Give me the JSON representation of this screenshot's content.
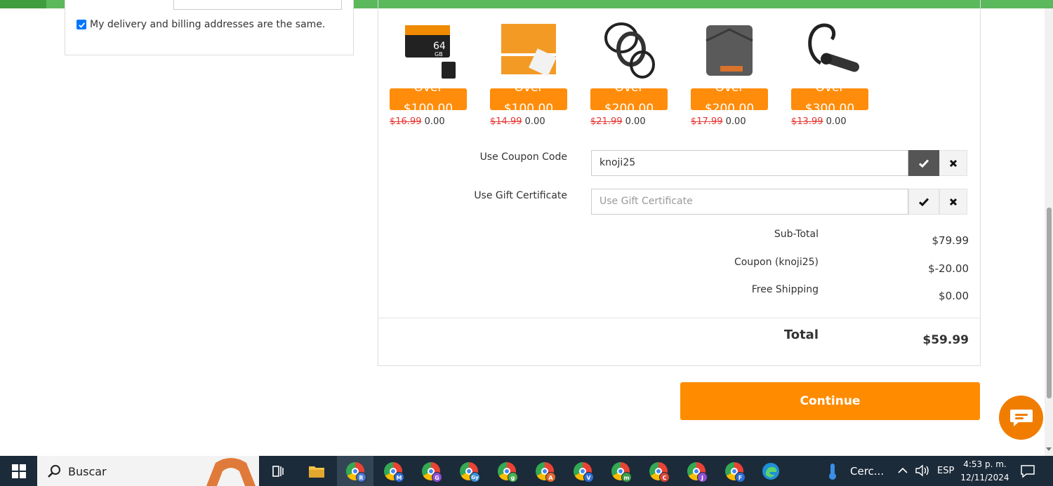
{
  "checkout": {
    "same_address_label": "My delivery and billing addresses are the same."
  },
  "products": [
    {
      "badge_line1": "Over",
      "badge_line2": "$100.00",
      "old_price": "$16.99",
      "new_price": "0.00",
      "icon": "memory-card-icon"
    },
    {
      "badge_line1": "Over",
      "badge_line2": "$100.00",
      "old_price": "$14.99",
      "new_price": "0.00",
      "icon": "cleaning-wipes-icon"
    },
    {
      "badge_line1": "Over",
      "badge_line2": "$200.00",
      "old_price": "$21.99",
      "new_price": "0.00",
      "icon": "filter-rings-icon"
    },
    {
      "badge_line1": "Over",
      "badge_line2": "$200.00",
      "old_price": "$17.99",
      "new_price": "0.00",
      "icon": "filter-wallet-icon"
    },
    {
      "badge_line1": "Over",
      "badge_line2": "$300.00",
      "old_price": "$13.99",
      "new_price": "0.00",
      "icon": "headset-icon"
    }
  ],
  "coupon": {
    "label": "Use Coupon Code",
    "value": "knoji25"
  },
  "gift": {
    "label": "Use Gift Certificate",
    "placeholder": "Use Gift Certificate"
  },
  "totals": {
    "subtotal_label": "Sub-Total",
    "subtotal_value": "$79.99",
    "coupon_label": "Coupon (knoji25)",
    "coupon_value": "$-20.00",
    "shipping_label": "Free Shipping",
    "shipping_value": "$0.00",
    "total_label": "Total",
    "total_value": "$59.99"
  },
  "continue_label": "Continue",
  "taskbar": {
    "search_text": "Buscar",
    "apps": [
      {
        "letter": "R",
        "color": "#4a7bd0"
      },
      {
        "letter": "M",
        "color": "#2f6fd6"
      },
      {
        "letter": "G",
        "color": "#8e4fd1"
      },
      {
        "letter": "Gy",
        "color": "#3a8fd6"
      },
      {
        "letter": "g",
        "color": "#4caf50"
      },
      {
        "letter": "A",
        "color": "#e56a2e"
      },
      {
        "letter": "V",
        "color": "#2f6fd6"
      },
      {
        "letter": "m",
        "color": "#3d9e4a"
      },
      {
        "letter": "C",
        "color": "#d9463b"
      },
      {
        "letter": "J",
        "color": "#8e4fd1"
      },
      {
        "letter": "F",
        "color": "#2f6fd6"
      }
    ],
    "weather_text": "Cerc...",
    "language": "ESP",
    "time": "4:53 p. m.",
    "date": "12/11/2024"
  }
}
